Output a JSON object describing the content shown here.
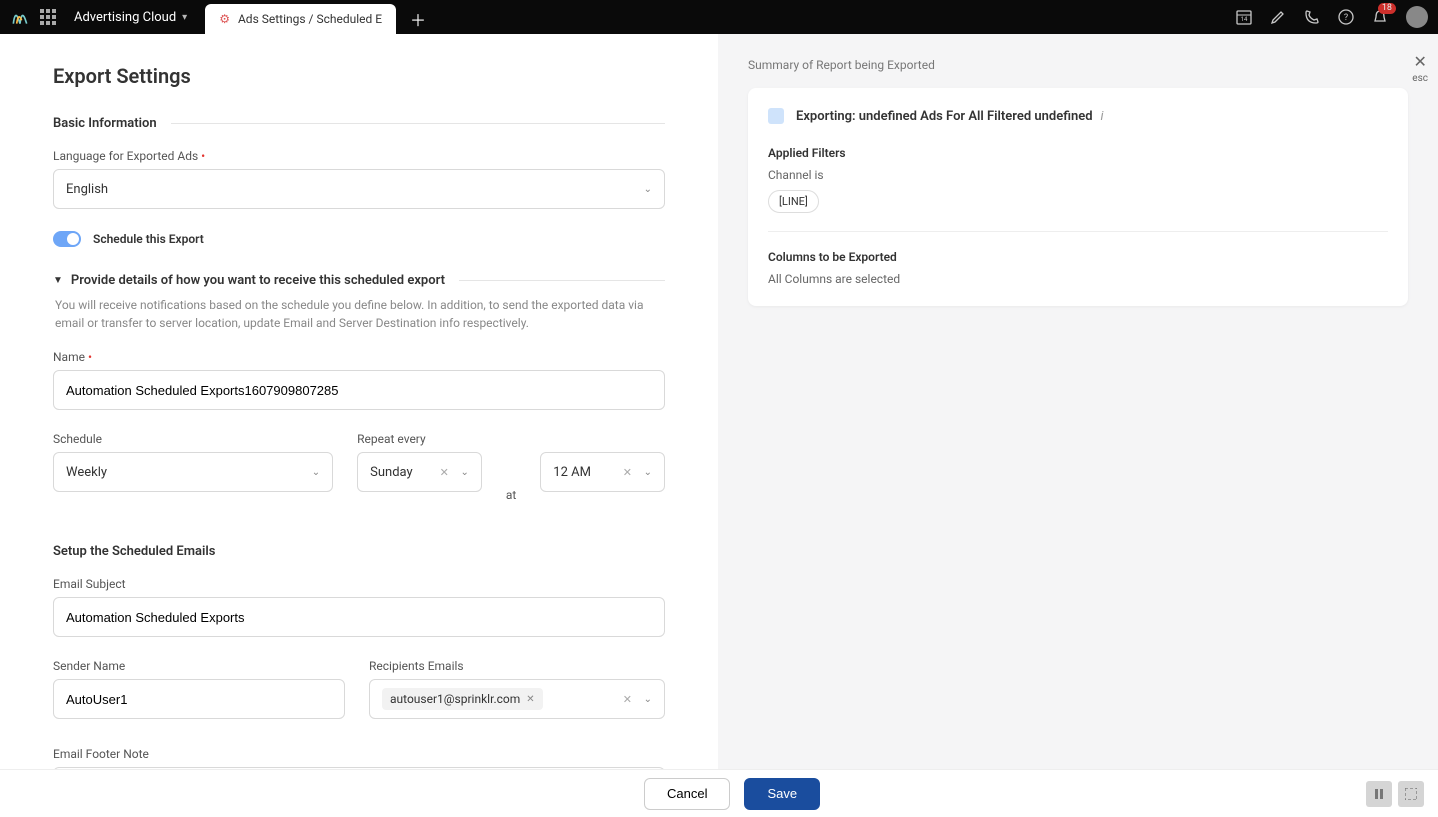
{
  "topbar": {
    "platform_dropdown": "Advertising Cloud",
    "tab_label": "Ads Settings / Scheduled E",
    "notification_count": "18"
  },
  "page": {
    "title": "Export Settings",
    "section_basic": "Basic Information",
    "language_label": "Language for Exported Ads",
    "language_value": "English",
    "schedule_toggle_label": "Schedule this Export",
    "schedule_details_heading": "Provide details of how you want to receive this scheduled export",
    "schedule_details_desc": "You will receive notifications based on the schedule you define below. In addition, to send the exported data via email or transfer to server location, update Email and Server Destination info respectively.",
    "name_label": "Name",
    "name_value": "Automation Scheduled Exports1607909807285",
    "schedule_label": "Schedule",
    "schedule_value": "Weekly",
    "repeat_label": "Repeat every",
    "repeat_day": "Sunday",
    "at_label": "at",
    "repeat_time": "12 AM",
    "emails_section": "Setup the Scheduled Emails",
    "email_subject_label": "Email Subject",
    "email_subject_value": "Automation Scheduled Exports",
    "sender_name_label": "Sender Name",
    "sender_name_value": "AutoUser1",
    "recipients_label": "Recipients Emails",
    "recipient_chip": "autouser1@sprinklr.com",
    "footer_note_label": "Email Footer Note"
  },
  "summary": {
    "title": "Summary of Report being Exported",
    "exporting": "Exporting: undefined Ads For All Filtered undefined",
    "applied_filters": "Applied Filters",
    "channel_label": "Channel is",
    "channel_value": "[LINE]",
    "columns_heading": "Columns to be Exported",
    "columns_text": "All Columns are selected",
    "close_esc": "esc"
  },
  "footer": {
    "cancel": "Cancel",
    "save": "Save"
  }
}
